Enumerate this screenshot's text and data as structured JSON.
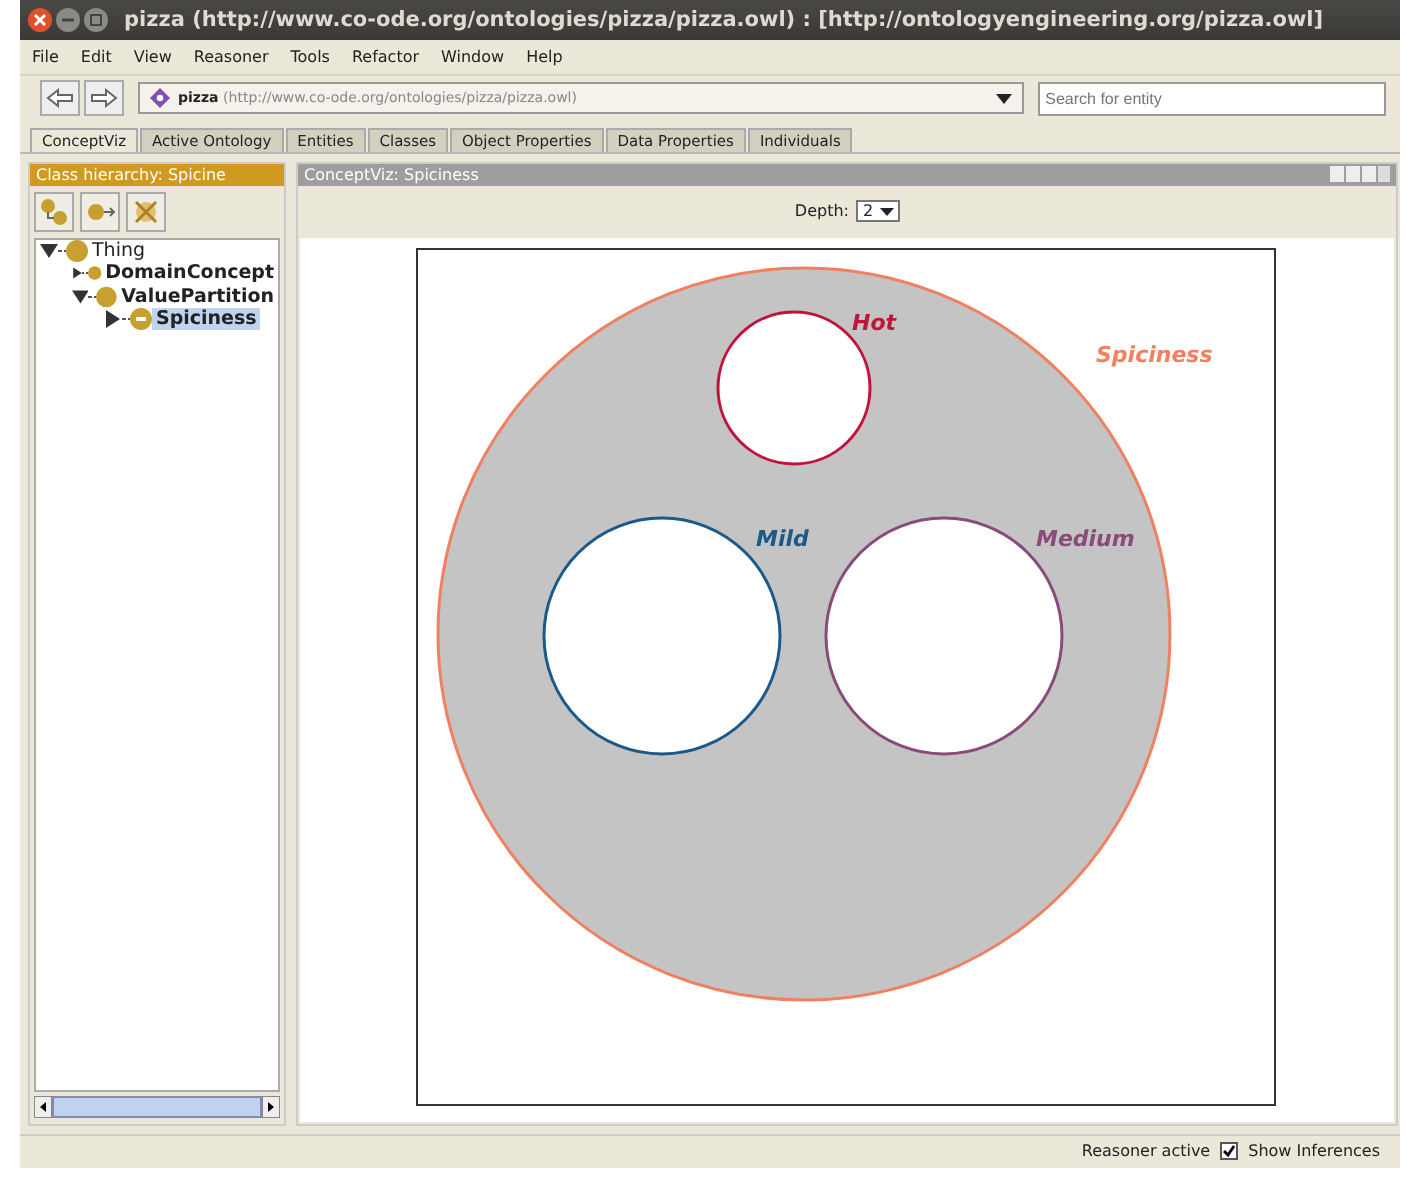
{
  "window": {
    "title": "pizza (http://www.co-ode.org/ontologies/pizza/pizza.owl)  : [http://ontologyengineering.org/pizza.owl]"
  },
  "menu": [
    "File",
    "Edit",
    "View",
    "Reasoner",
    "Tools",
    "Refactor",
    "Window",
    "Help"
  ],
  "ontology": {
    "name": "pizza",
    "iri": "(http://www.co-ode.org/ontologies/pizza/pizza.owl)"
  },
  "search": {
    "placeholder": "Search for entity"
  },
  "tabs": [
    {
      "label": "ConceptViz",
      "selected": true
    },
    {
      "label": "Active Ontology",
      "selected": false
    },
    {
      "label": "Entities",
      "selected": false
    },
    {
      "label": "Classes",
      "selected": false
    },
    {
      "label": "Object Properties",
      "selected": false
    },
    {
      "label": "Data Properties",
      "selected": false
    },
    {
      "label": "Individuals",
      "selected": false
    }
  ],
  "class_hierarchy": {
    "title": "Class hierarchy: Spicine",
    "tree": [
      {
        "label": "Thing",
        "expanded": true,
        "selected": false,
        "children": [
          {
            "label": "DomainConcept",
            "expanded": false,
            "selected": false
          },
          {
            "label": "ValuePartition",
            "expanded": true,
            "selected": false,
            "children": [
              {
                "label": "Spiciness",
                "expanded": false,
                "selected": true
              }
            ]
          }
        ]
      }
    ]
  },
  "conceptviz": {
    "title": "ConceptViz: Spiciness",
    "depth_label": "Depth:",
    "depth": "2",
    "diagram": {
      "label": "Spiciness",
      "color": "#f08060",
      "children": [
        {
          "label": "Hot",
          "color": "#c0143c"
        },
        {
          "label": "Mild",
          "color": "#1a5a8a"
        },
        {
          "label": "Medium",
          "color": "#8a4a7a"
        }
      ]
    }
  },
  "status_bar": {
    "text": "Reasoner active",
    "show_inferences": {
      "label": "Show Inferences",
      "checked": true
    }
  }
}
